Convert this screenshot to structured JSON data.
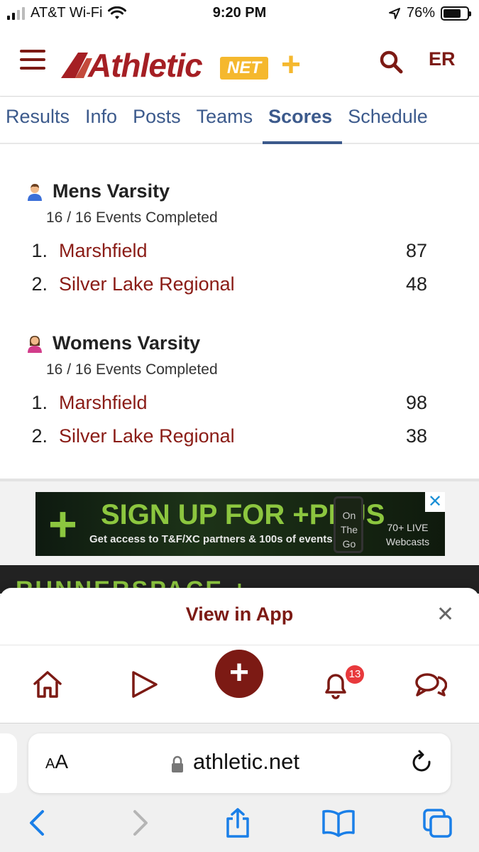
{
  "status_bar": {
    "carrier": "AT&T Wi-Fi",
    "time": "9:20 PM",
    "battery": "76%",
    "battery_level": 0.76
  },
  "header": {
    "logo_main": "Athletic",
    "logo_net": "NET",
    "logo_plus": "+",
    "lang": "ER"
  },
  "tabs": [
    {
      "label": "Results"
    },
    {
      "label": "Info"
    },
    {
      "label": "Posts"
    },
    {
      "label": "Teams"
    },
    {
      "label": "Scores",
      "active": true
    },
    {
      "label": "Schedule"
    }
  ],
  "scores": {
    "mens": {
      "title": "Mens Varsity",
      "events": "16 / 16  Events Completed",
      "rows": [
        {
          "rank": "1.",
          "team": "Marshfield",
          "points": "87"
        },
        {
          "rank": "2.",
          "team": "Silver Lake Regional",
          "points": "48"
        }
      ]
    },
    "womens": {
      "title": "Womens Varsity",
      "events": "16 / 16  Events Completed",
      "rows": [
        {
          "rank": "1.",
          "team": "Marshfield",
          "points": "98"
        },
        {
          "rank": "2.",
          "team": "Silver Lake Regional",
          "points": "38"
        }
      ]
    }
  },
  "ad": {
    "plus": "+",
    "headline": "SIGN UP FOR +PLUS",
    "subline": "Get access to T&F/XC partners & 100s of events!",
    "phone_text": "On The Go",
    "webcasts": "70+ LIVE Webcasts",
    "close": "✕"
  },
  "runnerspace": "RUNNERSPACE +",
  "view_in_app": {
    "label": "View in App",
    "close": "✕"
  },
  "app_nav": {
    "notification_count": "13",
    "add": "+"
  },
  "safari": {
    "aa_small": "A",
    "aa_large": "A",
    "url": "athletic.net"
  },
  "colors": {
    "brand_maroon": "#7c1a14",
    "team_link": "#8a1c16",
    "tab_blue": "#3c5a8c",
    "logo_gold": "#f5b82e",
    "ad_green": "#8cc63f",
    "ios_blue": "#1a7fe8"
  }
}
